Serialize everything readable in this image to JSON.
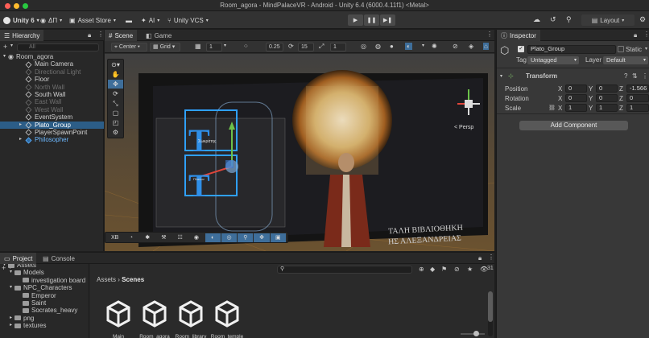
{
  "window": {
    "title": "Room_agora - MindPalaceVR - Android - Unity 6.4 (6000.4.11f1) <Metal>",
    "traffic_colors": [
      "#ff5f57",
      "#febc2e",
      "#28c840"
    ]
  },
  "toolbar": {
    "account_label": "Unity 6",
    "user_label": "ΔΠ",
    "asset_store_label": "Asset Store",
    "ai_label": "AI",
    "vcs_label": "Unity VCS",
    "layout_label": "Layout"
  },
  "hierarchy": {
    "tab_label": "Hierarchy",
    "search_placeholder": "All",
    "scene_name": "Room_agora",
    "items": [
      {
        "label": "Main Camera",
        "state": "normal"
      },
      {
        "label": "Directional Light",
        "state": "dim"
      },
      {
        "label": "Floor",
        "state": "normal"
      },
      {
        "label": "North Wall",
        "state": "dim"
      },
      {
        "label": "South Wall",
        "state": "normal"
      },
      {
        "label": "East Wall",
        "state": "dim"
      },
      {
        "label": "West Wall",
        "state": "dim"
      },
      {
        "label": "EventSystem",
        "state": "normal"
      },
      {
        "label": "Plato_Group",
        "state": "selected"
      },
      {
        "label": "PlayerSpawnPoint",
        "state": "normal"
      },
      {
        "label": "Philosopher",
        "state": "prefab"
      }
    ]
  },
  "scene": {
    "tabs": [
      "Scene",
      "Game"
    ],
    "pivot_label": "Center",
    "grid_label": "Grid",
    "grid_value": "1",
    "snap_value": "0.25",
    "angle_value": "15",
    "scale_value": "1",
    "persp_label": "< Persp",
    "mode_2d": "XB",
    "screen_text_1": "ΤΑΛΗ ΒΙΒΛΙΟΘΗΚΗ",
    "screen_text_2": "ΗΣ ΑΛΕΞΑΝΔΡΕΙΑΣ",
    "text_icon": "T",
    "small_label_1": "Σωκράτης",
    "small_label_2": "Πλατων"
  },
  "inspector": {
    "tab_label": "Inspector",
    "object_name": "Plato_Group",
    "static_label": "Static",
    "tag_label": "Tag",
    "tag_value": "Untagged",
    "layer_label": "Layer",
    "layer_value": "Default",
    "transform_label": "Transform",
    "rows": [
      {
        "label": "Position",
        "x": "0",
        "y": "0",
        "z": "-1.566"
      },
      {
        "label": "Rotation",
        "x": "0",
        "y": "0",
        "z": "0"
      },
      {
        "label": "Scale",
        "x": "1",
        "y": "1",
        "z": "1"
      }
    ],
    "add_component_label": "Add Component"
  },
  "project": {
    "tabs": [
      "Project",
      "Console"
    ],
    "breadcrumb_root": "Assets",
    "breadcrumb_leaf": "Scenes",
    "count": "31",
    "tree": [
      {
        "label": "Assets",
        "level": 0
      },
      {
        "label": "Models",
        "level": 1
      },
      {
        "label": "investigation board",
        "level": 2
      },
      {
        "label": "NPC_Characters",
        "level": 1
      },
      {
        "label": "Emperor",
        "level": 2
      },
      {
        "label": "Saint",
        "level": 2
      },
      {
        "label": "Socrates_heavy",
        "level": 2
      },
      {
        "label": "png",
        "level": 1
      },
      {
        "label": "textures",
        "level": 1
      }
    ],
    "assets": [
      "Main",
      "Room_agora",
      "Room_library",
      "Room_temple"
    ]
  },
  "colors": {
    "selection": "#2c5d87",
    "accent_blue": "#3e6e9a",
    "gizmo_x": "#e0453a",
    "gizmo_y": "#6cc24a",
    "gizmo_z": "#3a7bd5"
  }
}
